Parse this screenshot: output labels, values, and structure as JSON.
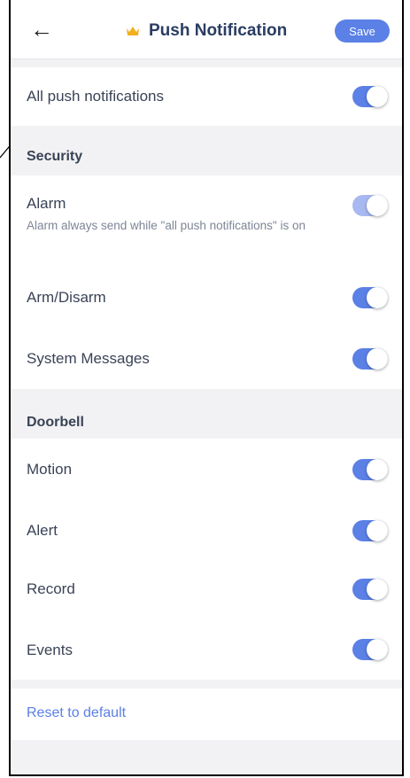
{
  "header": {
    "back_icon": "arrow-left-icon",
    "title": "Push Notification",
    "crown_icon": "crown-icon",
    "save_label": "Save"
  },
  "all_push": {
    "label": "All push notifications",
    "enabled": true
  },
  "security": {
    "heading": "Security",
    "items": [
      {
        "label": "Alarm",
        "subtitle": "Alarm always send while \"all push notifications\" is on",
        "enabled": true,
        "disabled": true
      },
      {
        "label": "Arm/Disarm",
        "enabled": true
      },
      {
        "label": "System Messages",
        "enabled": true
      }
    ]
  },
  "doorbell": {
    "heading": "Doorbell",
    "items": [
      {
        "label": "Motion",
        "enabled": true
      },
      {
        "label": "Alert",
        "enabled": true
      },
      {
        "label": "Record",
        "enabled": true
      },
      {
        "label": "Events",
        "enabled": true
      }
    ]
  },
  "reset_label": "Reset to default",
  "colors": {
    "accent": "#5b80e6",
    "accent_dim": "#a8b8f0",
    "crown": "#f2b01e"
  }
}
